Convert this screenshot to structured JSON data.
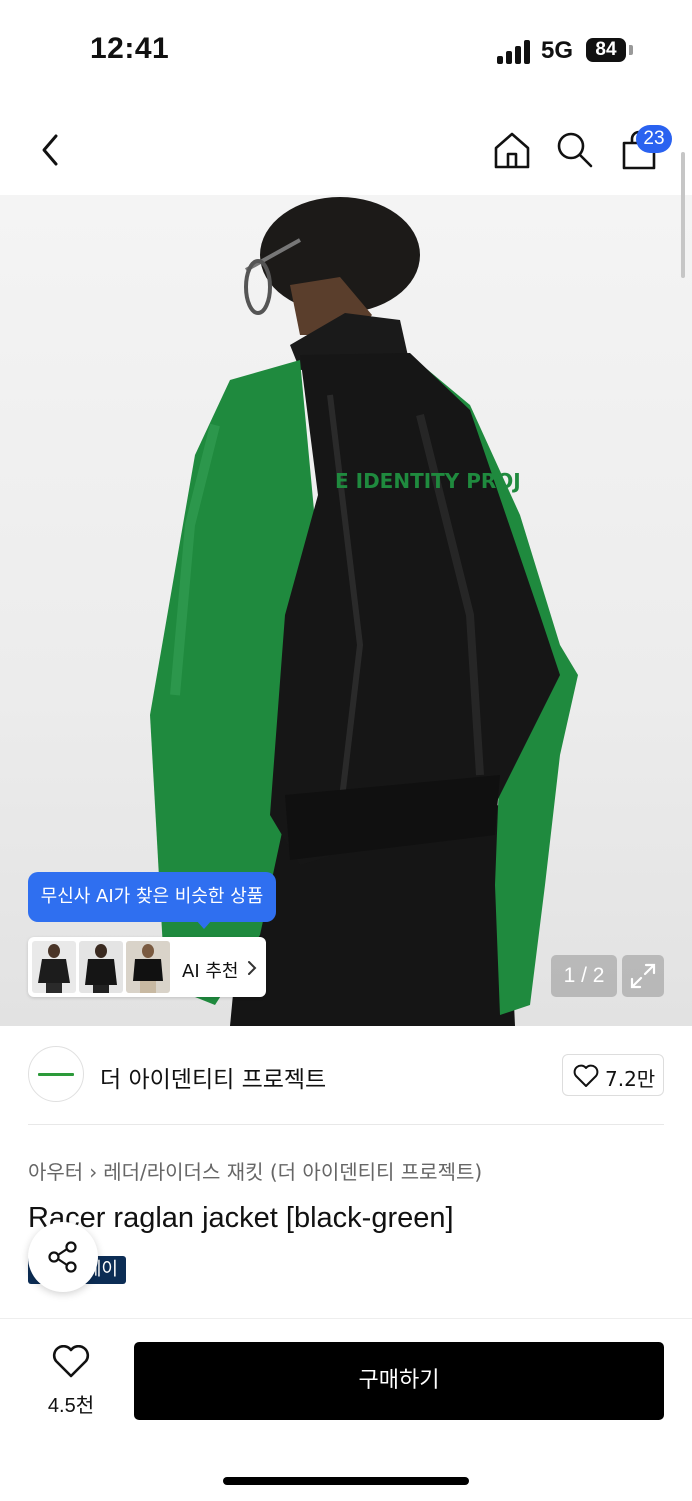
{
  "status_bar": {
    "time": "12:41",
    "network": "5G",
    "battery": "84"
  },
  "nav": {
    "cart_count": "23"
  },
  "gallery": {
    "ai_tooltip": "무신사 AI가 찾은 비슷한 상품",
    "ai_recommend_label": "AI 추천",
    "page_indicator": "1 / 2",
    "jacket_print": "E IDENTITY PROJ"
  },
  "brand": {
    "name": "더 아이덴티티 프로젝트",
    "likes": "7.2만"
  },
  "product": {
    "breadcrumb": [
      "아우터",
      "레더/라이더스 재킷 (더 아이덴티티 프로젝트)"
    ],
    "title": "Racer raglan jacket [black-green]",
    "badge": "페이"
  },
  "bottom_bar": {
    "wish_count": "4.5천",
    "buy_label": "구매하기"
  },
  "colors": {
    "accent_blue": "#2f6ff0",
    "badge_blue": "#2a62f0",
    "pay_badge": "#0c2d55",
    "jacket_green": "#1f8a3e"
  }
}
